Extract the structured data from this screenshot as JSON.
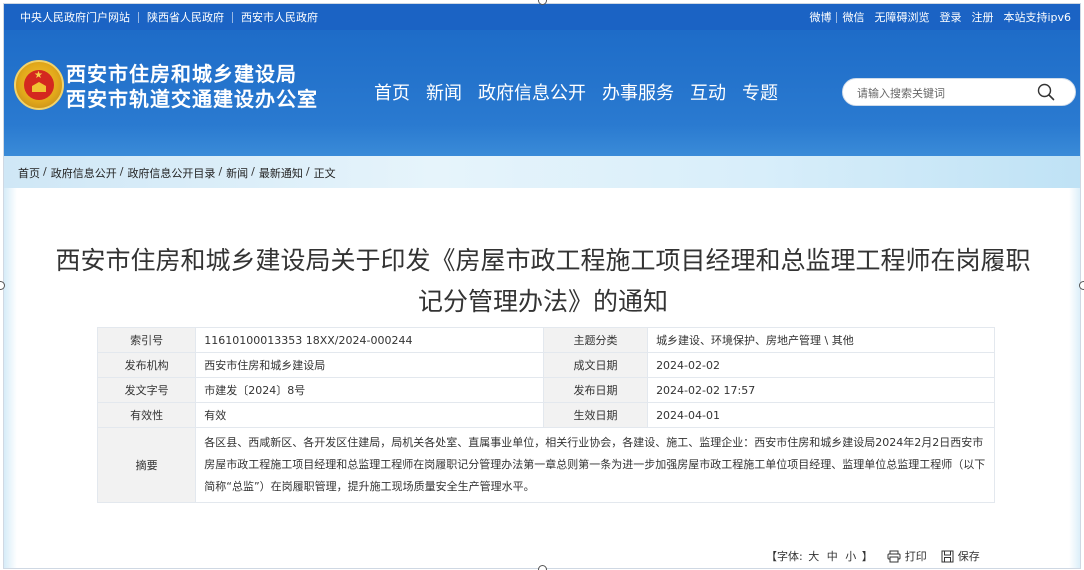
{
  "topbar": {
    "left_links": [
      "中央人民政府门户网站",
      "陕西省人民政府",
      "西安市人民政府"
    ],
    "right_links": [
      "微博",
      "微信",
      "无障碍浏览",
      "登录",
      "注册",
      "本站支持ipv6"
    ]
  },
  "header": {
    "site_name_line1": "西安市住房和城乡建设局",
    "site_name_line2": "西安市轨道交通建设办公室",
    "nav": [
      "首页",
      "新闻",
      "政府信息公开",
      "办事服务",
      "互动",
      "专题"
    ],
    "search_placeholder": "请输入搜索关键词"
  },
  "breadcrumb": [
    "首页",
    "政府信息公开",
    "政府信息公开目录",
    "新闻",
    "最新通知",
    "正文"
  ],
  "article": {
    "title": "西安市住房和城乡建设局关于印发《房屋市政工程施工项目经理和总监理工程师在岗履职记分管理办法》的通知"
  },
  "meta": {
    "index_label": "索引号",
    "index_value": "11610100013353 18XX/2024-000244",
    "category_label": "主题分类",
    "category_value": "城乡建设、环境保护、房地产管理 \\ 其他",
    "publisher_label": "发布机构",
    "publisher_value": "西安市住房和城乡建设局",
    "created_label": "成文日期",
    "created_value": "2024-02-02",
    "docno_label": "发文字号",
    "docno_value": "市建发〔2024〕8号",
    "published_label": "发布日期",
    "published_value": "2024-02-02 17:57",
    "validity_label": "有效性",
    "validity_value": "有效",
    "effective_label": "生效日期",
    "effective_value": "2024-04-01",
    "summary_label": "摘要",
    "summary_value": "各区县、西咸新区、各开发区住建局，局机关各处室、直属事业单位，相关行业协会，各建设、施工、监理企业：西安市住房和城乡建设局2024年2月2日西安市房屋市政工程施工项目经理和总监理工程师在岗履职记分管理办法第一章总则第一条为进一步加强房屋市政工程施工单位项目经理、监理单位总监理工程师（以下简称“总监”）在岗履职管理，提升施工现场质量安全生产管理水平。"
  },
  "tools": {
    "font_label": "【字体:",
    "font_sizes": [
      "大",
      "中",
      "小"
    ],
    "font_close": "】",
    "print_label": "打印",
    "save_label": "保存"
  },
  "colors": {
    "topbar": "#1b63c4",
    "header": "#1e6cc8",
    "breadcrumb_band": "#d8eefa"
  }
}
